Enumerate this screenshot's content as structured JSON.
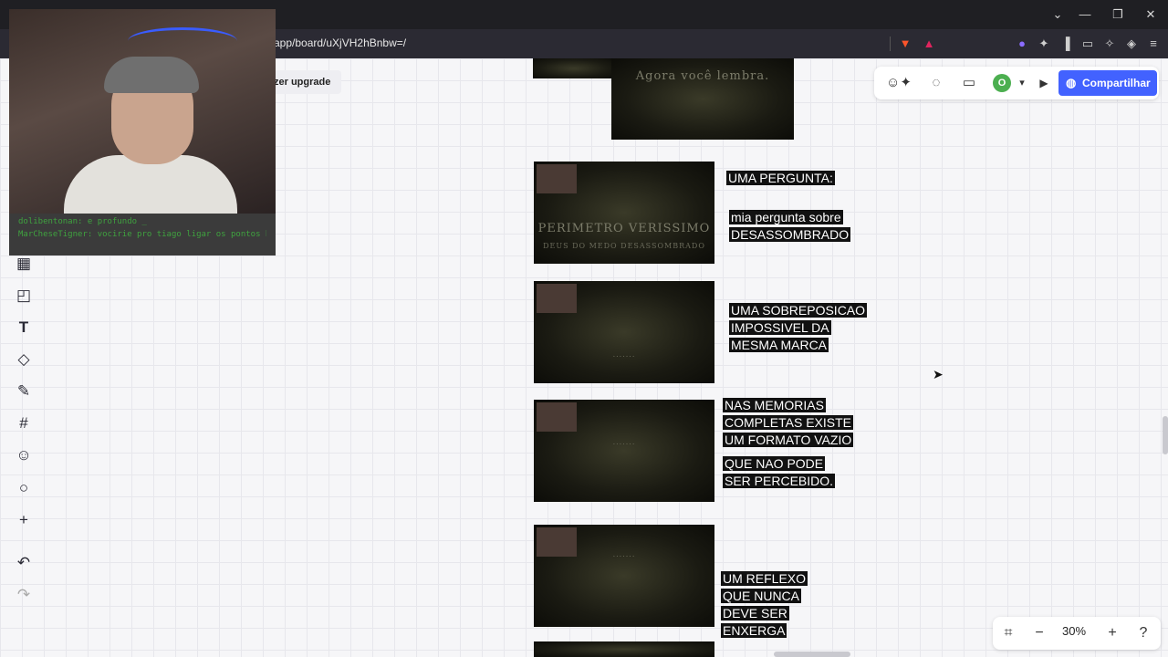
{
  "browser": {
    "url": "app/board/uXjVH2hBnbw=/",
    "window_controls": [
      "⌄",
      "—",
      "❐",
      "✕"
    ]
  },
  "board": {
    "upgrade_label": "zer upgrade",
    "share_label": "Compartilhar",
    "avatar_initial": "O",
    "zoom_level": "30%"
  },
  "chat": {
    "lines": [
      "dolibentonan: e profundo _",
      "MarCheseTigner: vocirie pro tiago ligar os pontos heheheh _"
    ]
  },
  "frames": [
    {
      "text_main": "Agora você lembra."
    },
    {
      "text_main": "PERIMETRO   VERISSIMO",
      "text_sub": "DEUS DO MEDO   DESASSOMBRADO"
    },
    {
      "text_main": "......."
    },
    {
      "text_main": "......."
    },
    {
      "text_main": "......."
    }
  ],
  "notes": {
    "n1": "UMA PERGUNTA:",
    "n2": "mia pergunta sobre DESASSOMBRADO",
    "n3": "UMA SOBREPOSICAO IMPOSSIVEL DA MESMA MARCA",
    "n4": "NAS MEMORIAS COMPLETAS EXISTE UM FORMATO VAZIO",
    "n5": "QUE NAO PODE  SER PERCEBIDO.",
    "n6": "UM REFLEXO  QUE NUNCA DEVE SER ENXERGA"
  },
  "icons": {
    "toolbar": [
      "template-icon",
      "sticky-note-icon",
      "text-icon",
      "shapes-icon",
      "pen-icon",
      "frame-icon",
      "sticker-icon",
      "comment-icon",
      "add-icon",
      "undo-icon",
      "redo-icon"
    ],
    "colors": {
      "share": "#4262ff",
      "avatar": "#4caf50"
    }
  }
}
